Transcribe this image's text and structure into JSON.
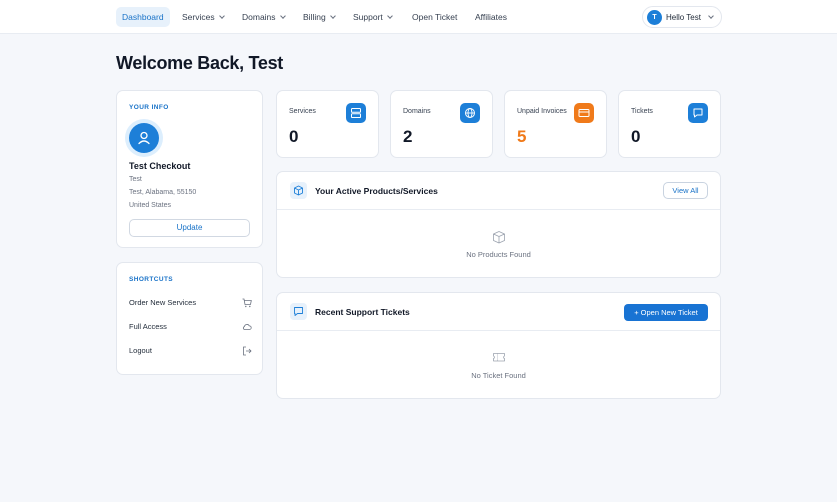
{
  "nav": {
    "items": [
      {
        "label": "Dashboard",
        "active": true,
        "dropdown": false
      },
      {
        "label": "Services",
        "dropdown": true
      },
      {
        "label": "Domains",
        "dropdown": true
      },
      {
        "label": "Billing",
        "dropdown": true
      },
      {
        "label": "Support",
        "dropdown": true
      },
      {
        "label": "Open Ticket",
        "dropdown": false
      },
      {
        "label": "Affiliates",
        "dropdown": false
      }
    ],
    "user": {
      "initial": "T",
      "label": "Hello Test"
    }
  },
  "page": {
    "title": "Welcome Back, Test"
  },
  "your_info": {
    "heading": "YOUR INFO",
    "name": "Test Checkout",
    "lines": [
      "Test",
      "Test, Alabama, 55150",
      "United States"
    ],
    "update_label": "Update"
  },
  "shortcuts": {
    "heading": "SHORTCUTS",
    "items": [
      {
        "label": "Order New Services",
        "icon": "cart-icon"
      },
      {
        "label": "Full Access",
        "icon": "cloud-icon"
      },
      {
        "label": "Logout",
        "icon": "logout-icon"
      }
    ]
  },
  "stats": [
    {
      "label": "Services",
      "value": "0",
      "icon": "server-icon",
      "color": "#1d7fd8"
    },
    {
      "label": "Domains",
      "value": "2",
      "icon": "globe-icon",
      "color": "#1d7fd8"
    },
    {
      "label": "Unpaid Invoices",
      "value": "5",
      "icon": "credit-card-icon",
      "color": "#f07a1a"
    },
    {
      "label": "Tickets",
      "value": "0",
      "icon": "chat-icon",
      "color": "#1d7fd8"
    }
  ],
  "products": {
    "title": "Your Active Products/Services",
    "button": "View All",
    "empty": "No Products Found"
  },
  "tickets": {
    "title": "Recent Support Tickets",
    "button": "+ Open New Ticket",
    "empty": "No Ticket Found"
  },
  "colors": {
    "accent": "#1d7fd8",
    "warning": "#f07a1a",
    "background": "#f5f7fb"
  }
}
